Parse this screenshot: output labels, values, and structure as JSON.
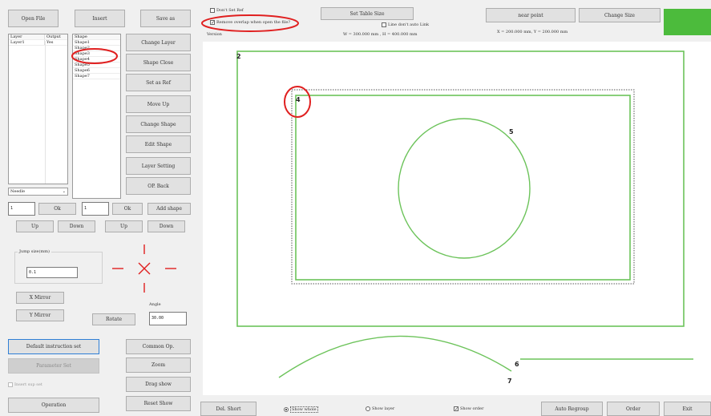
{
  "toolbar_left": {
    "open_file": "Open File",
    "insert": "Insert",
    "save_as": "Save as"
  },
  "top": {
    "dont_set_ref": "Don't Set Ref",
    "remove_overlap": "Remove overlap when open the file?",
    "version_label": "Version",
    "set_table_size": "Set Table Size",
    "line_dont_auto_link": "Line don't auto Link",
    "table_size_text": "W = 300.000 mm , H = 400.000 mm",
    "near_point": "near point",
    "change_size": "Change Size",
    "xy_text": "X = 200.000 mm, Y = 200.000 mm",
    "status_color": "#4cbb3c"
  },
  "layer_list": {
    "headers": [
      "Layer",
      "Output"
    ],
    "rows": [
      [
        "Layer1",
        "Yes"
      ]
    ]
  },
  "shape_list": {
    "header": "Shape",
    "items": [
      "Shape1",
      "Shape2",
      "Shape3",
      "Shape4",
      "Shape5",
      "Shape6",
      "Shape7"
    ]
  },
  "right_buttons": {
    "change_layer": "Change Layer",
    "shape_close": "Shape Close",
    "set_as_ref": "Set as Ref",
    "move_up": "Move Up",
    "change_shape": "Change Shape",
    "edit_shape": "Edit Shape",
    "layer_setting": "Layer Setting",
    "op_back": "OP. Back"
  },
  "dropdown": {
    "value": "Needle"
  },
  "controls": {
    "input1": "1",
    "ok1": "Ok",
    "input2": "1",
    "ok2": "Ok",
    "add_shape": "Add shape",
    "up1": "Up",
    "down1": "Down",
    "up2": "Up",
    "down2": "Down"
  },
  "jump": {
    "label": "Jump size(mm)",
    "value": "0.1"
  },
  "mirror": {
    "x_mirror": "X Mirror",
    "y_mirror": "Y Mirror",
    "rotate": "Rotate",
    "angle_label": "Angle",
    "angle_value": "30.00"
  },
  "bottom_left": {
    "default_instruction": "Default instruction set",
    "param_set": "Parameter Set",
    "insert_sup_set": "Insert sup set",
    "operation": "Operation",
    "common_op": "Common Op.",
    "zoom": "Zoom",
    "drag_show": "Drag show",
    "reset_show": "Reset Show"
  },
  "bottom_bar": {
    "del_short": "Del. Short",
    "show_whole": "Show whole",
    "show_layer": "Show layer",
    "show_order": "Show order",
    "auto_regroup": "Auto Regroup",
    "order": "Order",
    "exit": "Exit"
  },
  "canvas_labels": {
    "l2": "2",
    "l4": "4",
    "l5": "5",
    "l6": "6",
    "l7": "7"
  },
  "colors": {
    "shape_green": "#6cc35a",
    "highlight_red": "#e02020"
  }
}
